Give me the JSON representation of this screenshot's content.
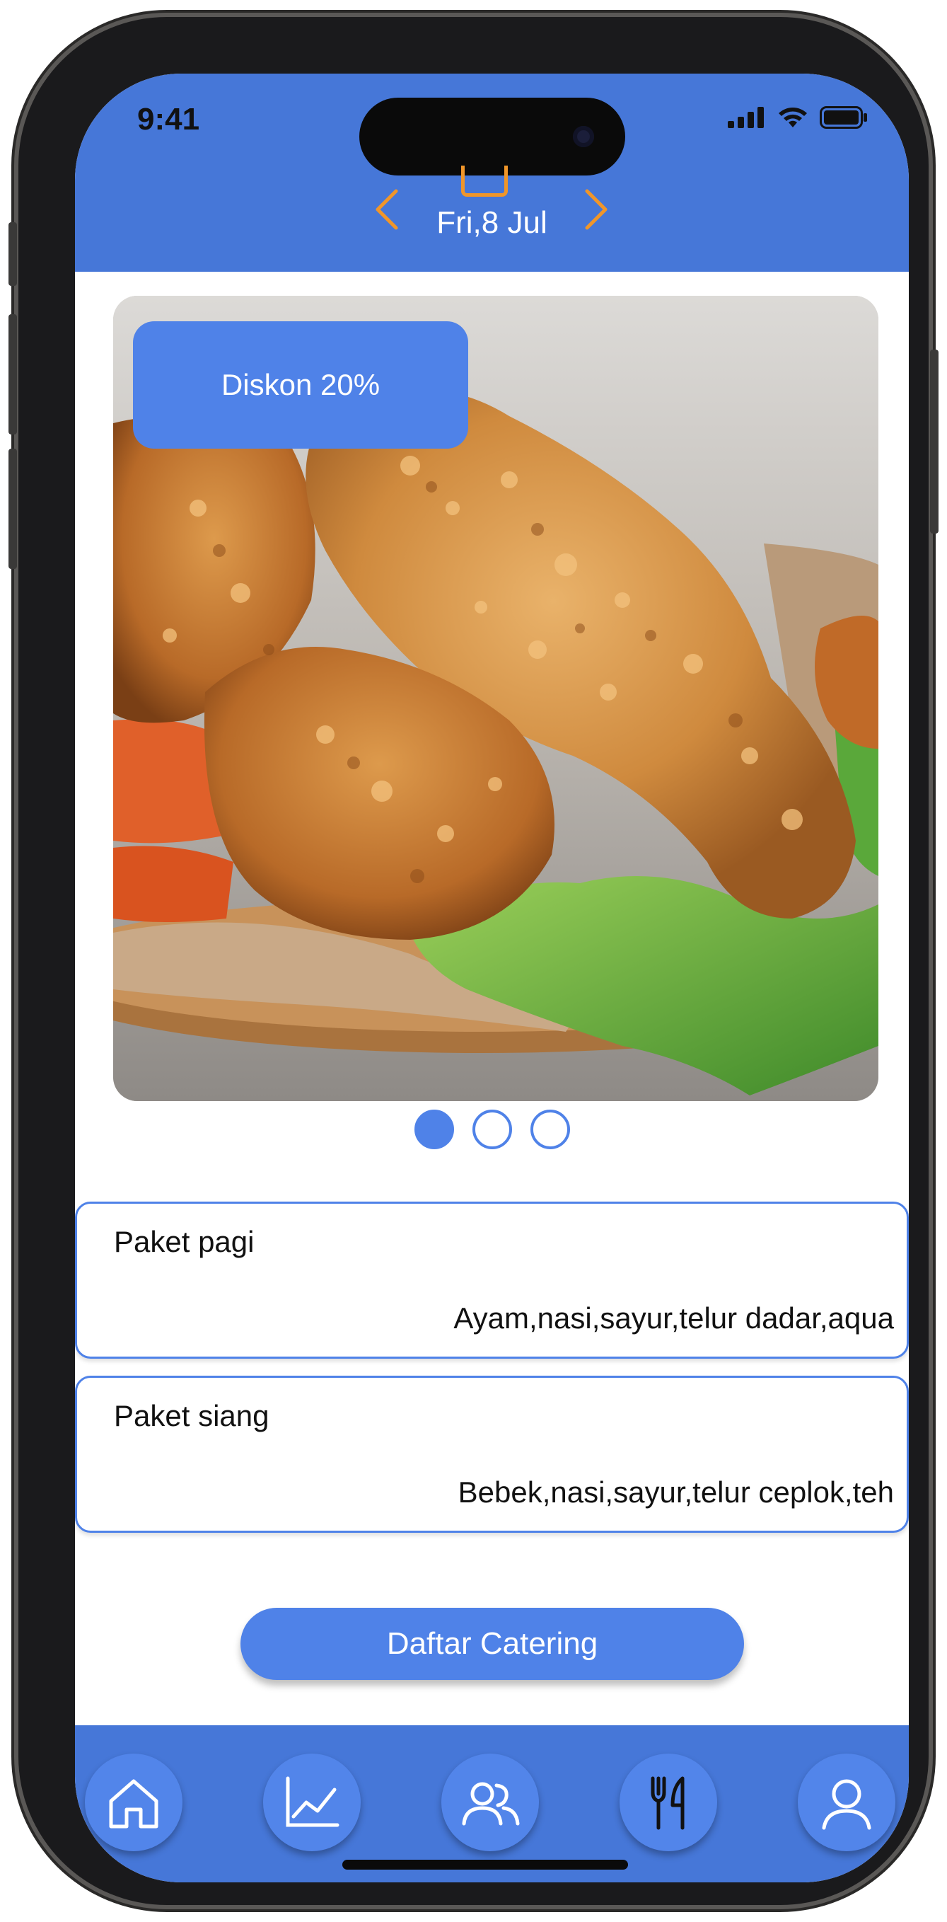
{
  "status_bar": {
    "time": "9:41",
    "icons": [
      "signal-icon",
      "wifi-icon",
      "battery-icon"
    ]
  },
  "date_nav": {
    "label": "Fri,8 Jul",
    "prev_icon": "chevron-left-icon",
    "next_icon": "chevron-right-icon",
    "calendar_icon": "calendar-icon"
  },
  "promo": {
    "badge_label": "Diskon 20%",
    "image_subject": "fried chicken on lettuce",
    "slides": 3,
    "active_slide": 1
  },
  "packages": [
    {
      "title": "Paket pagi",
      "description": "Ayam,nasi,sayur,telur dadar,aqua"
    },
    {
      "title": "Paket siang",
      "description": "Bebek,nasi,sayur,telur ceplok,teh"
    }
  ],
  "cta": {
    "label": "Daftar Catering"
  },
  "tabbar": {
    "items": [
      "home-icon",
      "chart-icon",
      "users-icon",
      "utensils-icon",
      "profile-icon"
    ]
  },
  "colors": {
    "primary": "#4677d8",
    "button": "#4f82e8",
    "accent": "#f0962a"
  }
}
